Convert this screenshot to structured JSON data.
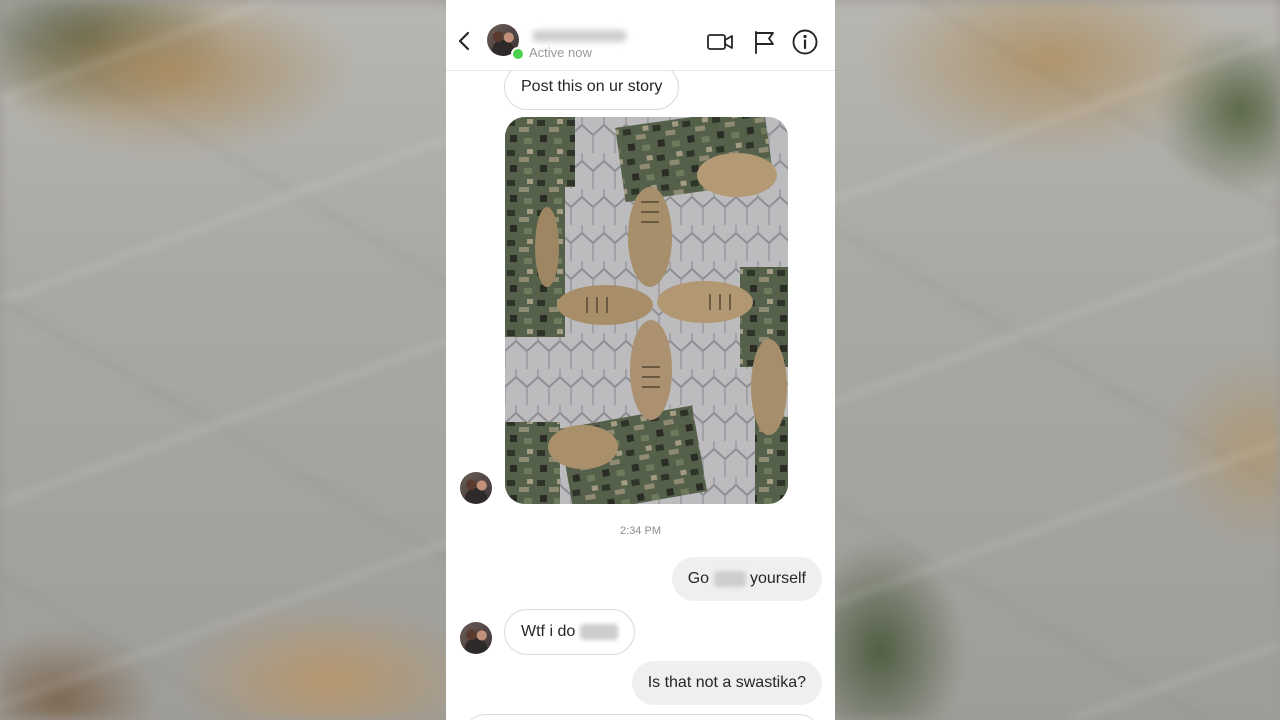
{
  "header": {
    "status": "Active now"
  },
  "messages": {
    "first": "Post this on ur story",
    "time": "2:34 PM",
    "reply_pre": "Go",
    "reply_post": "yourself",
    "question_pre": "Wtf i do",
    "last": "Is that not a swastika?"
  },
  "colors": {
    "online": "#4cd14c",
    "incoming_bubble": "#ffffff",
    "outgoing_bubble": "#efefef",
    "timestamp": "#8e8e8e"
  },
  "icons": [
    "back-chevron-icon",
    "video-call-icon",
    "flag-icon",
    "info-icon"
  ]
}
